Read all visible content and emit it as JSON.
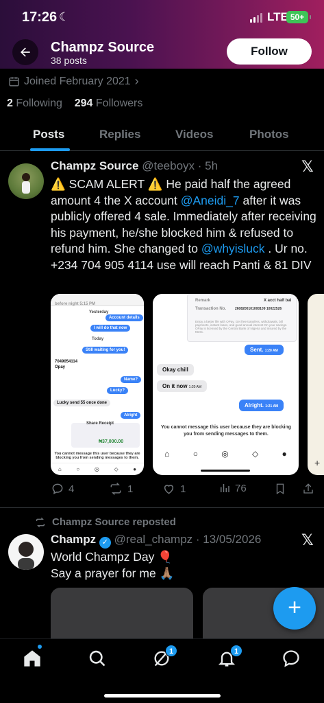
{
  "status_bar": {
    "time": "17:26",
    "network": "LTE",
    "battery": "50+"
  },
  "header": {
    "name": "Champz Source",
    "posts": "38 posts",
    "follow_label": "Follow"
  },
  "profile": {
    "joined": "Joined February 2021",
    "following_count": "2",
    "following_label": "Following",
    "followers_count": "294",
    "followers_label": "Followers"
  },
  "tabs": [
    "Posts",
    "Replies",
    "Videos",
    "Photos"
  ],
  "post1": {
    "name": "Champz Source",
    "handle": "@teeboyx · 5h",
    "text_1": "⚠️ SCAM ALERT ⚠️ He paid half the agreed amount 4 the X account ",
    "mention_1": "@Aneidi_7",
    "text_2": " after it was publicly offered 4 sale. Immediately after receiving his payment, he/she blocked him & refused to refund him. She changed to ",
    "mention_2": "@whyisluck",
    "text_3": " . Ur no. +234 704 905 4114 use will reach Panti & 81 DIV",
    "actions": {
      "replies": "4",
      "reposts": "1",
      "likes": "1",
      "views": "76"
    },
    "media1": {
      "header": "before night  5:15 PM",
      "yesterday": "Yesterday",
      "b1": "Account details",
      "b2": "I will do that now",
      "today": "Today",
      "b3": "Still waiting for you!",
      "acct": "7049054114",
      "opay": "Opay",
      "b4": "Name?",
      "b5": "Lucky?",
      "g1": "Lucky send 55 once done",
      "b6": "Alright",
      "receipt": "Share Receipt",
      "amount": "₦37,000.00",
      "blocked": "You cannot message this user because they are blocking you from sending messages to them."
    },
    "media2": {
      "remark": "Remark",
      "remark_val": "X acct half bal",
      "txn": "Transaction No.",
      "txn_val": "2608200101000109 10022526",
      "promo": "Enjoy a better life with OPay. Get free transfers, withdrawals, bill payments, instant loans, and good annual interest On your savings. OPay is licensed by the Central Bank of Nigeria and insured by the NDIC.",
      "sent": "Sent.",
      "sent_time": "1:20 AM",
      "g1": "Okay chill",
      "g2": "On it now",
      "g2_time": "1:20 AM",
      "b1": "Alright.",
      "b1_time": "1:21 AM",
      "blocked": "You cannot message this user because they are blocking you from sending messages to them."
    }
  },
  "repost_label": "Champz Source reposted",
  "post2": {
    "name": "Champz",
    "handle": "@real_champz · 13/05/2026",
    "line1": "World Champz Day 🎈",
    "line2": "Say a prayer for me 🙏🏽"
  },
  "nav": {
    "communities_badge": "1",
    "notifications_badge": "1"
  },
  "colors": {
    "accent": "#1d9bf0",
    "bg": "#000000",
    "muted": "#71767b"
  }
}
